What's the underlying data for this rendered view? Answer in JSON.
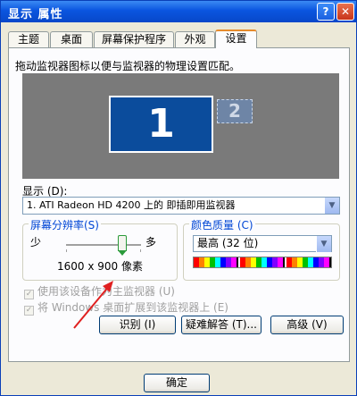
{
  "window": {
    "title": "显示 属性",
    "help_glyph": "?",
    "close_glyph": "✕"
  },
  "tabs": [
    "主题",
    "桌面",
    "屏幕保护程序",
    "外观",
    "设置"
  ],
  "active_tab": "设置",
  "settings": {
    "intro": "拖动监视器图标以便与监视器的物理设置匹配。",
    "monitor_1": "1",
    "monitor_2": "2",
    "display_label": "显示 (D):",
    "display_value": "1. ATI Radeon HD 4200 上的 即插即用监视器",
    "resolution_legend": "屏幕分辨率(S)",
    "resolution_less": "少",
    "resolution_more": "多",
    "resolution_value": "1600 x 900 像素",
    "color_legend": "颜色质量 (C)",
    "color_value": "最高 (32 位)",
    "check_primary": "使用该设备作为主监视器 (U)",
    "check_extend": "将 Windows 桌面扩展到该监视器上 (E)",
    "btn_identify": "识别 (I)",
    "btn_troubleshoot": "疑难解答 (T)...",
    "btn_advanced": "高级 (V)"
  },
  "footer": {
    "ok": "确定"
  },
  "colors": {
    "title_blue": "#0a55df",
    "legend_blue": "#0046d5",
    "monitor_blue": "#0b4c9c",
    "preview_gray": "#7a7a7a",
    "annotation_arrow": "#e02020"
  }
}
